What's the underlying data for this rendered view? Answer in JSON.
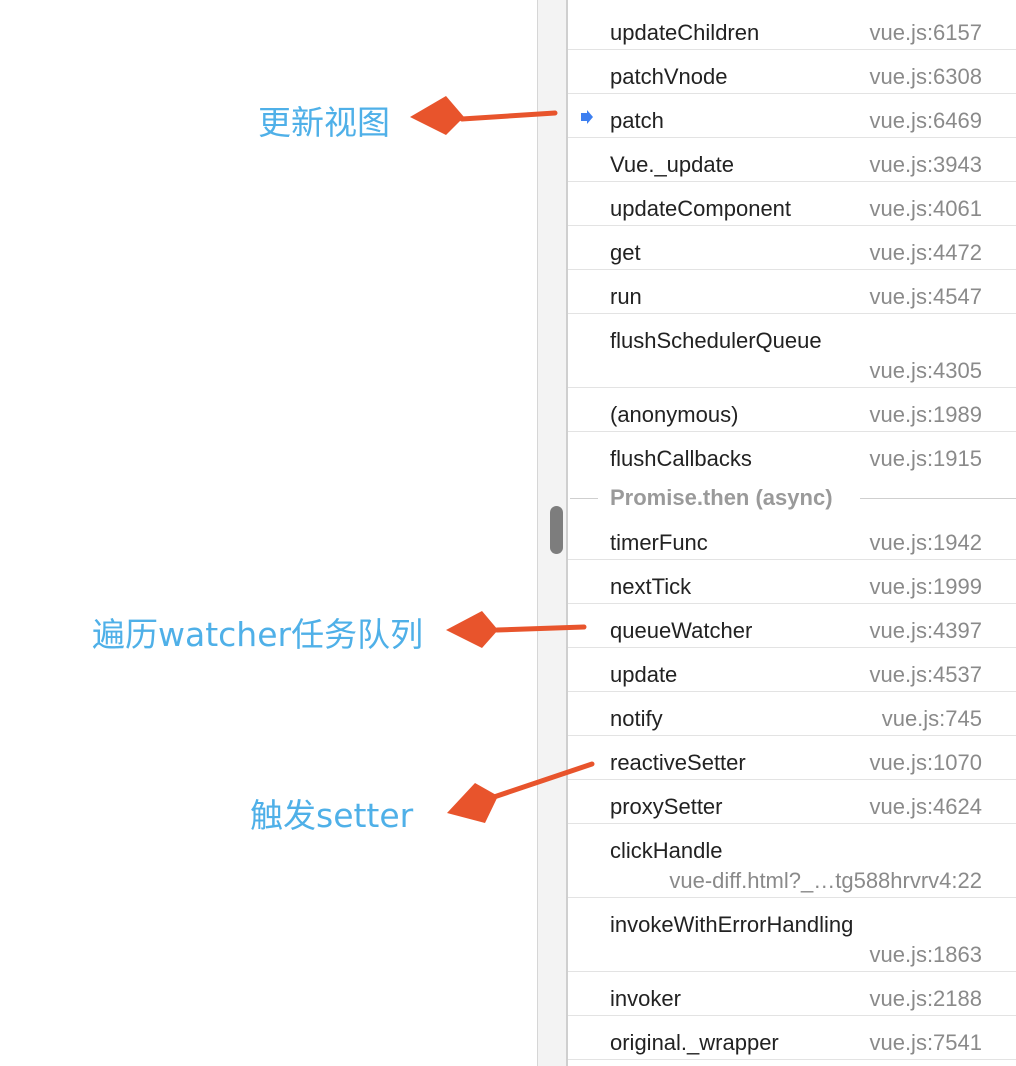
{
  "annotations": {
    "update_view": "更新视图",
    "traverse_watcher_queue": "遍历watcher任务队列",
    "trigger_setter": "触发setter"
  },
  "call_stack": {
    "frames": [
      {
        "name": "updateChildren",
        "location": "vue.js:6157"
      },
      {
        "name": "patchVnode",
        "location": "vue.js:6308"
      },
      {
        "name": "patch",
        "location": "vue.js:6469",
        "current": true
      },
      {
        "name": "Vue._update",
        "location": "vue.js:3943"
      },
      {
        "name": "updateComponent",
        "location": "vue.js:4061"
      },
      {
        "name": "get",
        "location": "vue.js:4472"
      },
      {
        "name": "run",
        "location": "vue.js:4547"
      },
      {
        "name": "flushSchedulerQueue",
        "location": "vue.js:4305"
      },
      {
        "name": "(anonymous)",
        "location": "vue.js:1989"
      },
      {
        "name": "flushCallbacks",
        "location": "vue.js:1915"
      },
      {
        "name": "timerFunc",
        "location": "vue.js:1942"
      },
      {
        "name": "nextTick",
        "location": "vue.js:1999"
      },
      {
        "name": "queueWatcher",
        "location": "vue.js:4397"
      },
      {
        "name": "update",
        "location": "vue.js:4537"
      },
      {
        "name": "notify",
        "location": "vue.js:745"
      },
      {
        "name": "reactiveSetter",
        "location": "vue.js:1070"
      },
      {
        "name": "proxySetter",
        "location": "vue.js:4624"
      },
      {
        "name": "clickHandle",
        "location": "vue-diff.html?_…tg588hrvrv4:22"
      },
      {
        "name": "invokeWithErrorHandling",
        "location": "vue.js:1863"
      },
      {
        "name": "invoker",
        "location": "vue.js:2188"
      },
      {
        "name": "original._wrapper",
        "location": "vue.js:7541"
      }
    ],
    "async_separator": "Promise.then (async)"
  },
  "colors": {
    "annotation_text": "#4fb0e8",
    "arrow": "#e8542c",
    "current_frame_marker": "#3d7ff0"
  },
  "icons": {
    "current_frame_marker": "blue-arrow-marker-icon"
  }
}
